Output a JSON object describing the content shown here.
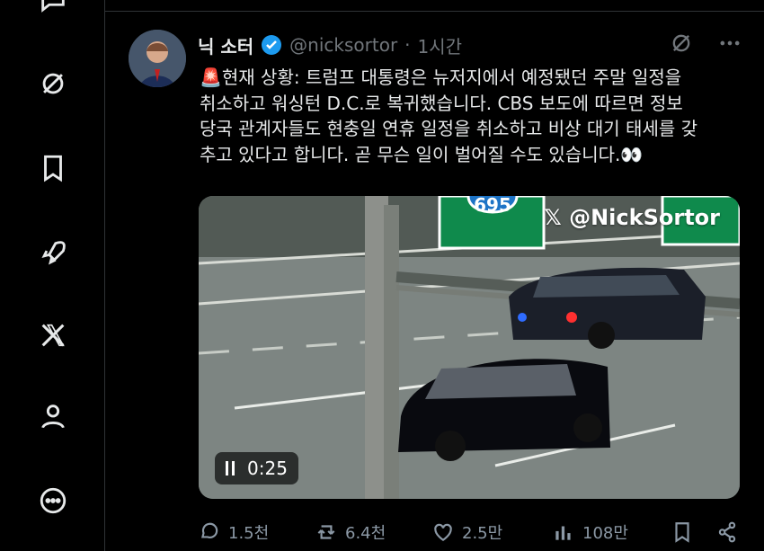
{
  "sidebar": {
    "items": [
      {
        "icon": "message-icon"
      },
      {
        "icon": "grok-icon"
      },
      {
        "icon": "bookmark-icon"
      },
      {
        "icon": "rocket-icon"
      },
      {
        "icon": "x-logo-icon"
      },
      {
        "icon": "profile-icon"
      },
      {
        "icon": "more-icon"
      }
    ]
  },
  "tweet": {
    "author_name": "닉 소터",
    "handle": "@nicksortor",
    "separator": "·",
    "time": "1시간",
    "text": "🚨현재 상황: 트럼프 대통령은 뉴저지에서 예정됐던 주말 일정을\n취소하고 워싱턴 D.C.로 복귀했습니다. CBS 보도에 따르면 정보\n당국 관계자들도 현충일 연휴 일정을 취소하고 비상 대기 태세를 갖\n추고 있다고 합니다. 곧 무슨 일이 벌어질 수도 있습니다.👀",
    "media": {
      "watermark": "𝕏 @NickSortor",
      "sign_number": "695",
      "duration": "0:25"
    },
    "stats": {
      "replies": "1.5천",
      "retweets": "6.4천",
      "likes": "2.5만",
      "views": "108만"
    }
  },
  "colors": {
    "background": "#000000",
    "text": "#e7e9ea",
    "muted": "#71767b",
    "verified": "#1d9bf0",
    "sign_green": "#0f8a4c"
  }
}
